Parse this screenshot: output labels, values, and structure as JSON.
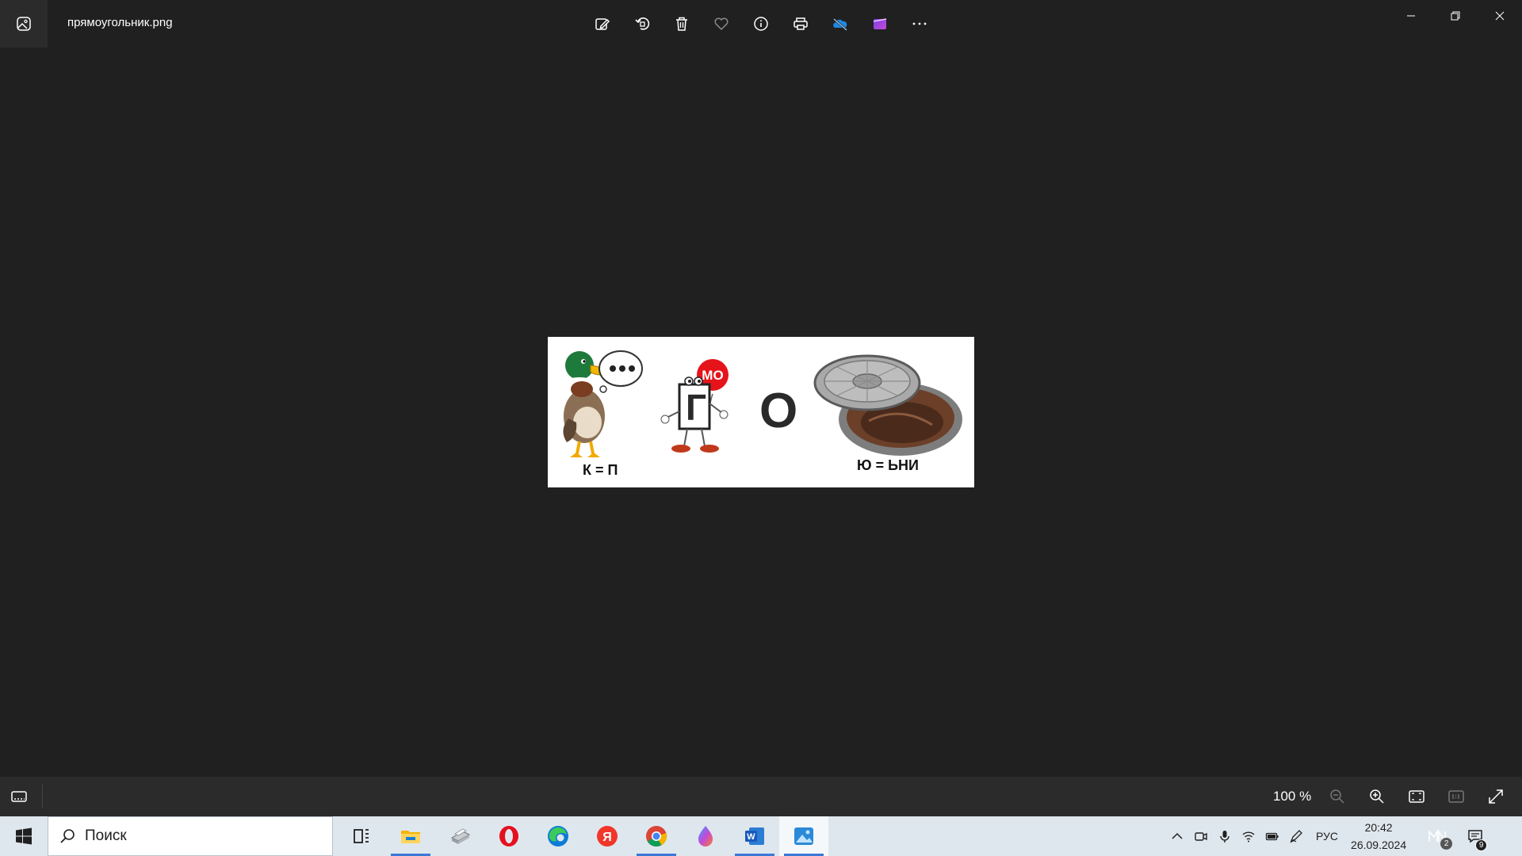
{
  "window": {
    "file_name": "прямоугольник.png",
    "toolbar": [
      {
        "name": "edit-image-icon",
        "tip": "Изменить"
      },
      {
        "name": "rotate-icon",
        "tip": "Повернуть"
      },
      {
        "name": "delete-icon",
        "tip": "Удалить"
      },
      {
        "name": "favorite-heart-icon",
        "tip": "Избранное"
      },
      {
        "name": "info-icon",
        "tip": "Сведения"
      },
      {
        "name": "print-icon",
        "tip": "Печать"
      },
      {
        "name": "onedrive-icon",
        "tip": "OneDrive"
      },
      {
        "name": "clipchamp-icon",
        "tip": "Clipchamp"
      },
      {
        "name": "more-icon",
        "tip": "Подробнее"
      }
    ]
  },
  "picture": {
    "balloon_text": "МО",
    "letter_g": "Г",
    "letter_o": "О",
    "label_duck": "К = П",
    "label_hatch": "Ю = ЬНИ"
  },
  "statusbar": {
    "zoom": "100 %"
  },
  "taskbar": {
    "search_placeholder": "Поиск",
    "language": "РУС",
    "time": "20:42",
    "date": "26.09.2024",
    "meet_badge": "2",
    "notifications_badge": "9",
    "apps": [
      {
        "name": "task-view",
        "running": false,
        "active": false
      },
      {
        "name": "file-explorer",
        "running": true,
        "active": false
      },
      {
        "name": "scanner-app",
        "running": false,
        "active": false
      },
      {
        "name": "opera",
        "running": false,
        "active": false
      },
      {
        "name": "edge",
        "running": false,
        "active": false
      },
      {
        "name": "yandex-browser",
        "running": false,
        "active": false
      },
      {
        "name": "chrome",
        "running": true,
        "active": false
      },
      {
        "name": "paint-drop",
        "running": false,
        "active": false
      },
      {
        "name": "word",
        "running": true,
        "active": false
      },
      {
        "name": "photos",
        "running": true,
        "active": true
      }
    ]
  },
  "colors": {
    "background": "#202020",
    "accent": "#3b78d8",
    "balloon": "#e5141a"
  }
}
